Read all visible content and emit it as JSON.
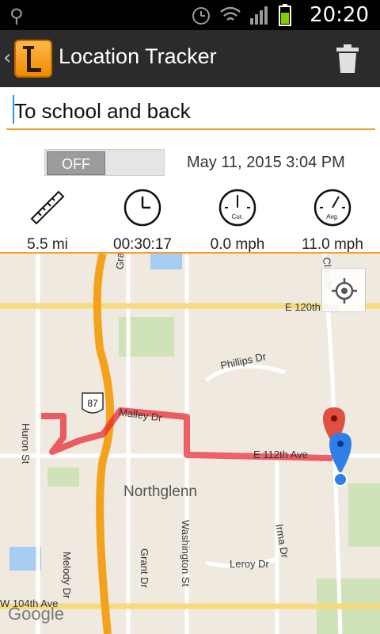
{
  "status_bar": {
    "time": "20:20",
    "icons": [
      "usb-icon",
      "alarm-icon",
      "wifi-icon",
      "signal-icon",
      "battery-icon"
    ]
  },
  "action_bar": {
    "title": "Location Tracker",
    "app_icon_letter": "L",
    "trash_icon": "trash-icon"
  },
  "trip": {
    "name": "To school and back",
    "toggle_label": "OFF",
    "date": "May 11, 2015 3:04 PM"
  },
  "stats": [
    {
      "icon": "ruler-icon",
      "value": "5.5 mi"
    },
    {
      "icon": "clock-icon",
      "value": "00:30:17"
    },
    {
      "icon": "speedometer-icon",
      "value": "0.0 mph",
      "icon_label": "Cur."
    },
    {
      "icon": "speedometer-icon",
      "value": "11.0 mph",
      "icon_label": "Avg."
    }
  ],
  "map": {
    "city": "Northglenn",
    "roads": [
      "E 120th Ave",
      "Grant St",
      "Phillips Dr",
      "Huron St",
      "Malley Dr",
      "E 112th Ave",
      "Grant Dr",
      "Washington St",
      "Irma Dr",
      "Leroy Dr",
      "Melody Dr",
      "W 104th Ave",
      "Claude"
    ],
    "highway_shield": "87",
    "attribution": "Google",
    "colors": {
      "route": "#e8202a",
      "highway": "#f4a21c",
      "start_pin": "#e05040",
      "current_pin": "#2f7fe8"
    }
  }
}
